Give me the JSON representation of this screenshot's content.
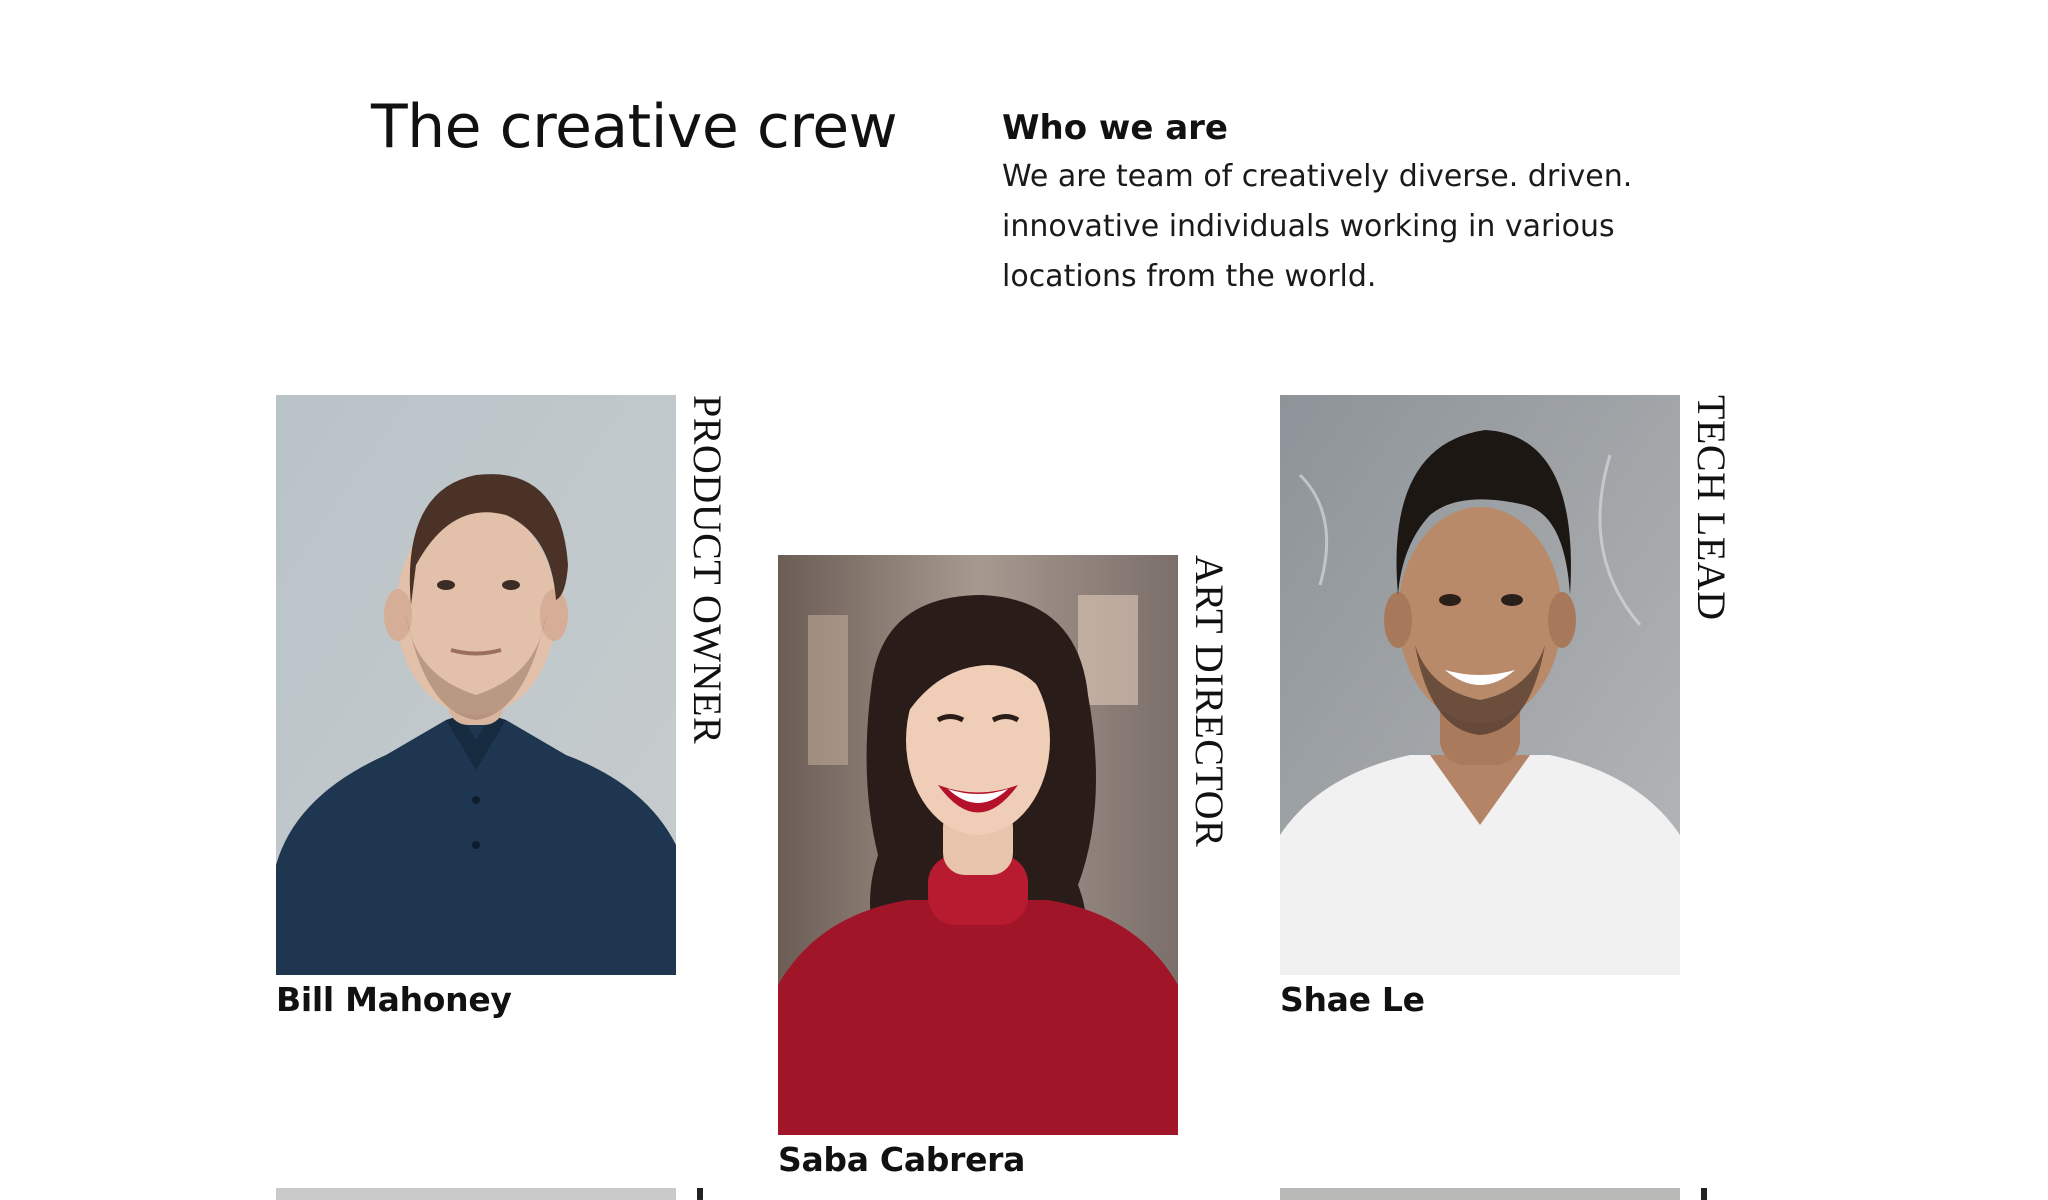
{
  "header": {
    "title": "The creative crew"
  },
  "about": {
    "title": "Who we are",
    "lines": [
      "We are team of creatively diverse. driven.",
      "innovative individuals working in various",
      "locations from the world."
    ]
  },
  "team": [
    {
      "name": "Bill Mahoney",
      "role": "PRODUCT OWNER",
      "photo_icon": "man-blue-polo-portrait"
    },
    {
      "name": "Saba Cabrera",
      "role": "ART DIRECTOR",
      "photo_icon": "woman-red-sweater-portrait"
    },
    {
      "name": "Shae Le",
      "role": "TECH LEAD",
      "photo_icon": "man-white-tshirt-portrait"
    }
  ],
  "colors": {
    "text": "#111111",
    "background": "#ffffff"
  }
}
